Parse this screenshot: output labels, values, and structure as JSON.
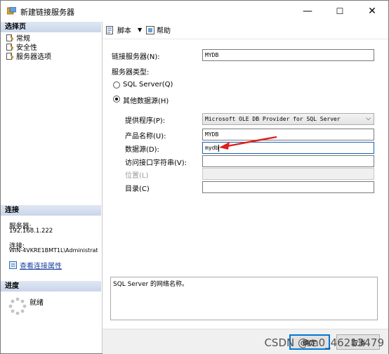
{
  "window": {
    "title": "新建链接服务器",
    "minimize": "—",
    "maximize": "☐",
    "close": "✕"
  },
  "left": {
    "header_pages": "选择页",
    "pages": [
      {
        "label": "常规",
        "icon": "page-icon"
      },
      {
        "label": "安全性",
        "icon": "page-icon"
      },
      {
        "label": "服务器选项",
        "icon": "page-icon"
      }
    ],
    "header_connection": "连接",
    "server_label": "服务器:",
    "server_value": "192.168.1.222",
    "connection_label": "连接:",
    "connection_value": "WIN-4VKRE1BMT1L\\Administrat",
    "view_props_link": "查看连接属性",
    "header_progress": "进度",
    "progress_status": "就绪"
  },
  "toolbar": {
    "script_label": "脚本",
    "help_label": "帮助"
  },
  "form": {
    "linked_server_label": "链接服务器(N):",
    "linked_server_value": "MYDB",
    "server_type_label": "服务器类型:",
    "radio_sql_label": "SQL Server(Q)",
    "radio_other_label": "其他数据源(H)",
    "provider_label": "提供程序(P):",
    "provider_value": "Microsoft OLE DB Provider for SQL Server",
    "product_label": "产品名称(U):",
    "product_value": "MYDB",
    "datasource_label": "数据源(D):",
    "datasource_value": "mydb",
    "provider_string_label": "访问接口字符串(V):",
    "provider_string_value": "",
    "location_label": "位置(L)",
    "location_value": "",
    "catalog_label": "目录(C)",
    "catalog_value": ""
  },
  "description": "SQL Server 的网络名称。",
  "footer": {
    "ok_label": "确定",
    "cancel_label": "取消"
  },
  "watermark": "CSDN @m0_46213479",
  "colors": {
    "accent": "#0078d7",
    "annotation_arrow": "#e0201b",
    "header_bg": "#c9d6ea",
    "link": "#1a3f9c"
  }
}
